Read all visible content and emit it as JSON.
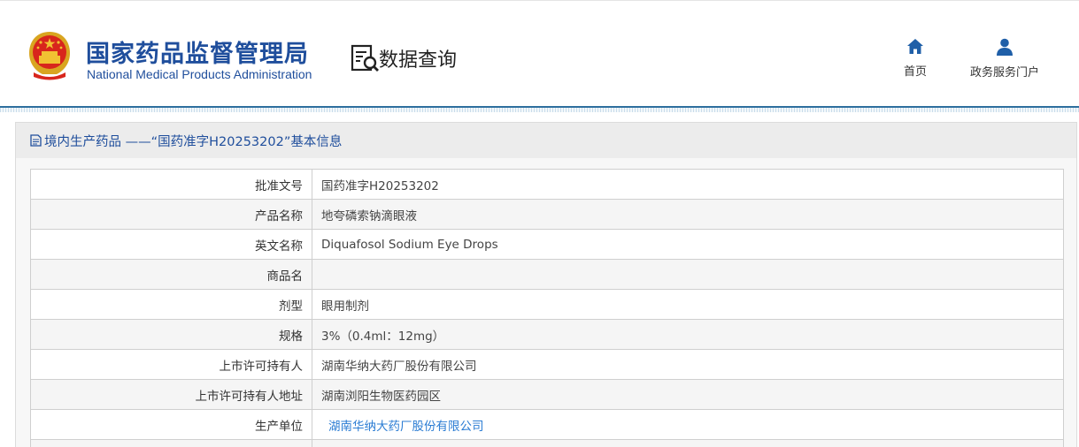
{
  "header": {
    "org_cn": "国家药品监督管理局",
    "org_en": "National Medical Products Administration",
    "query_label": "数据查询",
    "nav": [
      {
        "label": "首页",
        "icon": "home-icon"
      },
      {
        "label": "政务服务门户",
        "icon": "user-icon"
      }
    ]
  },
  "panel": {
    "title": "境内生产药品 ——“国药准字H20253202”基本信息",
    "icon": "document-icon"
  },
  "rows": [
    {
      "label": "批准文号",
      "value": "国药准字H20253202"
    },
    {
      "label": "产品名称",
      "value": "地夸磷索钠滴眼液"
    },
    {
      "label": "英文名称",
      "value": "Diquafosol Sodium Eye Drops"
    },
    {
      "label": "商品名",
      "value": ""
    },
    {
      "label": "剂型",
      "value": "眼用制剂"
    },
    {
      "label": "规格",
      "value": "3%（0.4ml：12mg）"
    },
    {
      "label": "上市许可持有人",
      "value": "湖南华纳大药厂股份有限公司"
    },
    {
      "label": "上市许可持有人地址",
      "value": "湖南浏阳生物医药园区"
    },
    {
      "label": "生产单位",
      "value": "湖南华纳大药厂股份有限公司"
    }
  ],
  "colors": {
    "brand": "#1f4e9c",
    "link": "#2b7cd3",
    "divider": "#2e6f9e"
  }
}
